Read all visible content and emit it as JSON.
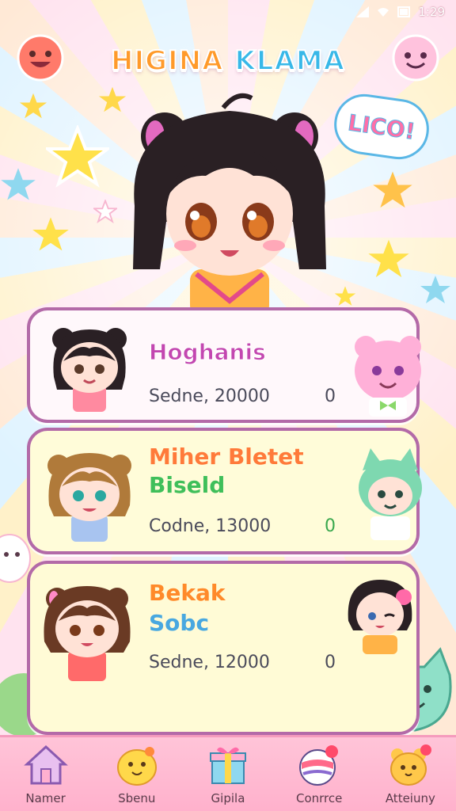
{
  "status_bar": {
    "time": "1:29",
    "icons": [
      "signal-icon",
      "wifi-icon",
      "battery-icon"
    ]
  },
  "header": {
    "title_word_1": "HIGINA",
    "title_word_2": "KLAMA",
    "speech_bubble": "LICO!"
  },
  "cards": [
    {
      "name_line_1": "Hoghanis",
      "score_label": "Sedne, 20000",
      "badge": "0"
    },
    {
      "name_line_1": "Miher Bletet",
      "name_line_2": "Biseld",
      "score_label": "Codne, 13000",
      "badge": "0"
    },
    {
      "name_line_1": "Bekak",
      "name_line_2": "Sobc",
      "score_label": "Sedne, 12000",
      "badge": "0"
    }
  ],
  "nav": {
    "items": [
      {
        "label": "Namer",
        "icon": "home-icon"
      },
      {
        "label": "Sbenu",
        "icon": "chick-icon"
      },
      {
        "label": "Gipila",
        "icon": "gift-box-icon"
      },
      {
        "label": "Conrrce",
        "icon": "ball-icon"
      },
      {
        "label": "Atteiuny",
        "icon": "bear-icon"
      }
    ]
  },
  "colors": {
    "accent_pink": "#ffb1cc",
    "card_border": "#b36aa8",
    "title_orange": "#ff9a2a",
    "title_blue": "#38b8e8"
  }
}
